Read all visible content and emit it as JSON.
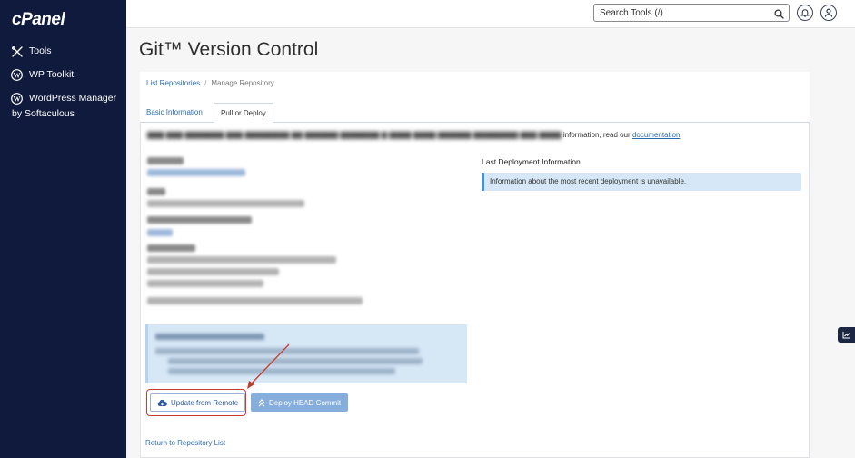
{
  "sidebar": {
    "logo": "cPanel",
    "items": [
      {
        "label": "Tools",
        "icon": "tools-icon"
      },
      {
        "label": "WP Toolkit",
        "icon": "wordpress-icon"
      },
      {
        "label": "WordPress Manager",
        "label2": "by Softaculous",
        "icon": "wordpress-icon"
      }
    ]
  },
  "topbar": {
    "search_placeholder": "Search Tools (/)"
  },
  "page": {
    "title": "Git™ Version Control",
    "breadcrumb": {
      "link": "List Repositories",
      "current": "Manage Repository"
    },
    "tabs": [
      {
        "label": "Basic Information",
        "active": false
      },
      {
        "label": "Pull or Deploy",
        "active": true
      }
    ],
    "intro_visible": "information, read our",
    "intro_link": "documentation",
    "intro_end": ".",
    "last_deployment": {
      "title": "Last Deployment Information",
      "info": "Information about the most recent deployment is unavailable."
    },
    "buttons": {
      "update": "Update from Remote",
      "deploy": "Deploy HEAD Commit"
    },
    "return_link": "Return to Repository List"
  },
  "colors": {
    "sidebar_bg": "#101a3c",
    "link": "#2b6cb0",
    "highlight": "#c43b2f",
    "deploy_btn": "#86aedc"
  }
}
